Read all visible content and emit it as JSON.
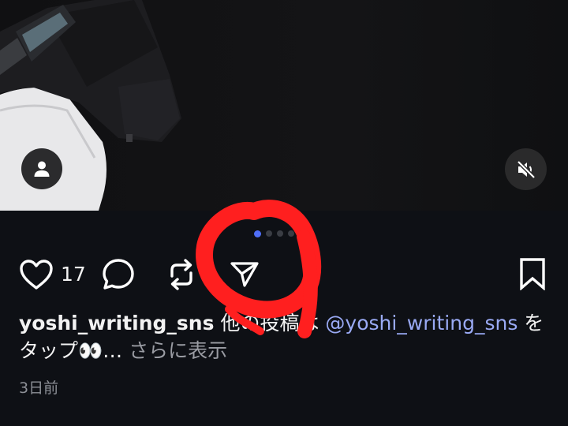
{
  "post": {
    "like_count": "17",
    "username": "yoshi_writing_sns",
    "caption_text_before_mention": " 他の投稿は ",
    "mention": "@yoshi_writing_sns",
    "caption_text_after_mention": " をタップ👀…",
    "more_label": " さらに表示",
    "timestamp": "3日前"
  },
  "carousel": {
    "total_dots": 6,
    "active_index": 0
  },
  "icons": {
    "tag_people": "person-icon",
    "mute": "speaker-muted-icon",
    "like": "heart-icon",
    "comment": "comment-bubble-icon",
    "repost": "repost-icon",
    "share": "paper-plane-icon",
    "save": "bookmark-icon"
  },
  "colors": {
    "background": "#0e1015",
    "accent_dot": "#4f6ef7",
    "mention": "#9aaaf5",
    "annotation": "#ff1f1f"
  }
}
